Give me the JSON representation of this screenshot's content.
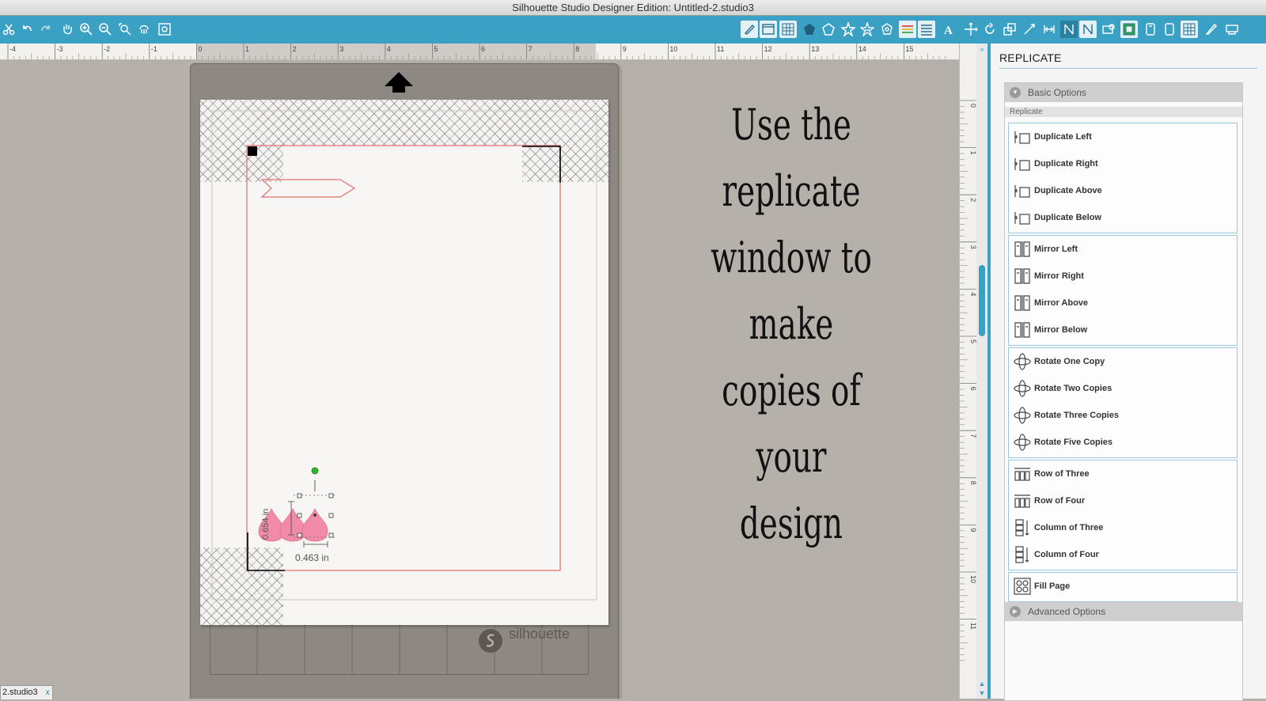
{
  "window": {
    "title": "Silhouette Studio Designer Edition: Untitled-2.studio3"
  },
  "toolbar": {
    "left_tools": [
      "scissors-icon",
      "undo-icon",
      "redo-icon",
      "pan-hand-icon",
      "zoom-in-icon",
      "zoom-out-icon",
      "zoom-select-icon",
      "zoom-drag-icon",
      "zoom-fit-icon"
    ],
    "right_tools": [
      "page-settings-icon",
      "grid-settings-icon",
      "cut-settings-icon",
      "fill-color-icon",
      "line-color-icon",
      "line-style-icon",
      "gradient-icon",
      "pattern-icon",
      "text-style-icon",
      "align-icon",
      "transform-icon",
      "rotate-icon",
      "scale-icon",
      "point-edit-icon",
      "offset-icon",
      "replicate-icon",
      "modify-icon",
      "knife-icon",
      "trace-icon",
      "store-icon",
      "library-icon",
      "send-icon",
      "settings-icon"
    ]
  },
  "ruler": {
    "top_labels": [
      "-4",
      "-3",
      "-2",
      "-1",
      "0",
      "1",
      "2",
      "3",
      "4",
      "5",
      "6",
      "7",
      "8",
      "9",
      "10",
      "11",
      "12",
      "13",
      "14",
      "15"
    ],
    "side_labels": [
      "0",
      "1",
      "2",
      "3",
      "4",
      "5",
      "6",
      "7",
      "8",
      "9",
      "10",
      "11"
    ]
  },
  "canvas": {
    "annotation_lines": [
      "Use the replicate",
      "window to make",
      "copies of your",
      "design"
    ],
    "mat_brand": "silhouette",
    "dimension_width": "0.463 in",
    "dimension_height": "0.654 in"
  },
  "document_tab": {
    "label": "2.studio3",
    "close": "x"
  },
  "panel": {
    "title": "REPLICATE",
    "basic_options_label": "Basic Options",
    "replicate_sublabel": "Replicate",
    "advanced_options_label": "Advanced Options",
    "groups": [
      [
        {
          "label": "Duplicate Left",
          "icon": "duplicate-left-icon"
        },
        {
          "label": "Duplicate Right",
          "icon": "duplicate-right-icon"
        },
        {
          "label": "Duplicate Above",
          "icon": "duplicate-above-icon"
        },
        {
          "label": "Duplicate Below",
          "icon": "duplicate-below-icon"
        }
      ],
      [
        {
          "label": "Mirror Left",
          "icon": "mirror-left-icon"
        },
        {
          "label": "Mirror Right",
          "icon": "mirror-right-icon"
        },
        {
          "label": "Mirror Above",
          "icon": "mirror-above-icon"
        },
        {
          "label": "Mirror Below",
          "icon": "mirror-below-icon"
        }
      ],
      [
        {
          "label": "Rotate One Copy",
          "icon": "rotate-one-copy-icon"
        },
        {
          "label": "Rotate Two Copies",
          "icon": "rotate-two-copies-icon"
        },
        {
          "label": "Rotate Three Copies",
          "icon": "rotate-three-copies-icon"
        },
        {
          "label": "Rotate Five Copies",
          "icon": "rotate-five-copies-icon"
        }
      ],
      [
        {
          "label": "Row of Three",
          "icon": "row-of-three-icon"
        },
        {
          "label": "Row of Four",
          "icon": "row-of-four-icon"
        },
        {
          "label": "Column of Three",
          "icon": "column-of-three-icon"
        },
        {
          "label": "Column of Four",
          "icon": "column-of-four-icon"
        }
      ],
      [
        {
          "label": "Fill Page",
          "icon": "fill-page-icon"
        }
      ]
    ]
  },
  "colors": {
    "toolbar": "#3aa0c4",
    "cut_line": "#e07070",
    "teardrop_fill": "#f28ba8",
    "selection_handle": "#2fb52f"
  }
}
